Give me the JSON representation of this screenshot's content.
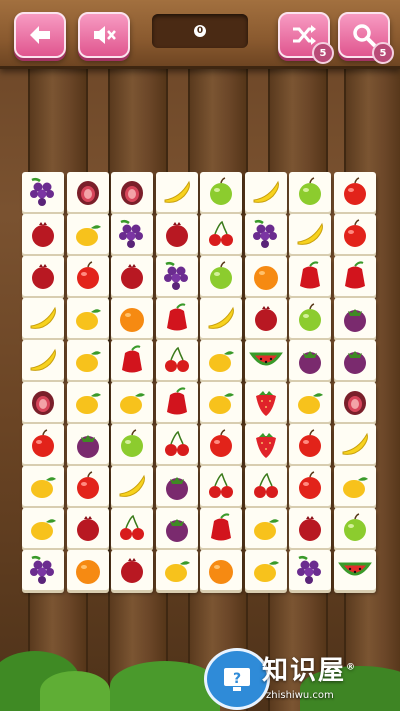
{
  "header": {
    "score": "0",
    "shuffle_count": "5",
    "hint_count": "5"
  },
  "board": {
    "columns": 8,
    "rows": 10,
    "tiles": [
      [
        "grape",
        "fig",
        "fig",
        "banana",
        "green-apple",
        "banana",
        "green-apple",
        "red-apple"
      ],
      [
        "pomegranate",
        "mango",
        "grape",
        "pomegranate",
        "cherry",
        "grape",
        "banana",
        "red-apple"
      ],
      [
        "pomegranate",
        "red-apple",
        "pomegranate",
        "grape",
        "green-apple",
        "orange",
        "rose-apple",
        "rose-apple"
      ],
      [
        "banana",
        "mango",
        "orange",
        "rose-apple",
        "banana",
        "pomegranate",
        "green-apple",
        "mangosteen"
      ],
      [
        "banana",
        "mango",
        "rose-apple",
        "cherry",
        "mango",
        "watermelon",
        "mangosteen",
        "mangosteen"
      ],
      [
        "fig",
        "mango",
        "mango",
        "rose-apple",
        "mango",
        "strawberry",
        "mango",
        "fig"
      ],
      [
        "red-apple",
        "mangosteen",
        "green-apple",
        "cherry",
        "red-apple",
        "strawberry",
        "red-apple",
        "banana"
      ],
      [
        "mango",
        "red-apple",
        "banana",
        "mangosteen",
        "cherry",
        "cherry",
        "red-apple",
        "mango"
      ],
      [
        "mango",
        "pomegranate",
        "cherry",
        "mangosteen",
        "rose-apple",
        "mango",
        "pomegranate",
        "green-apple"
      ],
      [
        "grape",
        "orange",
        "pomegranate",
        "mango",
        "orange",
        "mango",
        "grape",
        "watermelon"
      ]
    ]
  },
  "watermark": {
    "title": "知识屋",
    "subtitle": "zhishiwu.com",
    "registered": "®"
  }
}
